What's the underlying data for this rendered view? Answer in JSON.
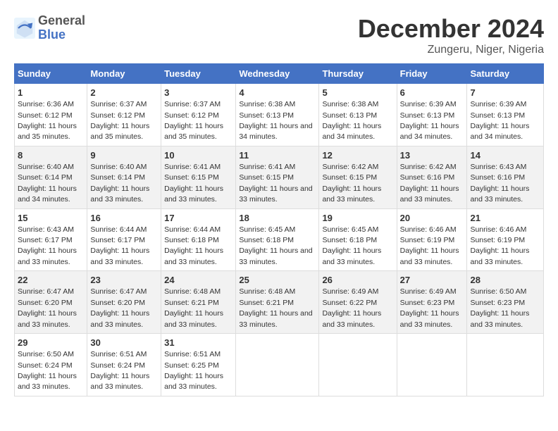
{
  "header": {
    "logo_line1": "General",
    "logo_line2": "Blue",
    "title": "December 2024",
    "subtitle": "Zungeru, Niger, Nigeria"
  },
  "days_of_week": [
    "Sunday",
    "Monday",
    "Tuesday",
    "Wednesday",
    "Thursday",
    "Friday",
    "Saturday"
  ],
  "weeks": [
    [
      {
        "day": "1",
        "sunrise": "6:36 AM",
        "sunset": "6:12 PM",
        "daylight": "11 hours and 35 minutes."
      },
      {
        "day": "2",
        "sunrise": "6:37 AM",
        "sunset": "6:12 PM",
        "daylight": "11 hours and 35 minutes."
      },
      {
        "day": "3",
        "sunrise": "6:37 AM",
        "sunset": "6:12 PM",
        "daylight": "11 hours and 35 minutes."
      },
      {
        "day": "4",
        "sunrise": "6:38 AM",
        "sunset": "6:13 PM",
        "daylight": "11 hours and 34 minutes."
      },
      {
        "day": "5",
        "sunrise": "6:38 AM",
        "sunset": "6:13 PM",
        "daylight": "11 hours and 34 minutes."
      },
      {
        "day": "6",
        "sunrise": "6:39 AM",
        "sunset": "6:13 PM",
        "daylight": "11 hours and 34 minutes."
      },
      {
        "day": "7",
        "sunrise": "6:39 AM",
        "sunset": "6:13 PM",
        "daylight": "11 hours and 34 minutes."
      }
    ],
    [
      {
        "day": "8",
        "sunrise": "6:40 AM",
        "sunset": "6:14 PM",
        "daylight": "11 hours and 34 minutes."
      },
      {
        "day": "9",
        "sunrise": "6:40 AM",
        "sunset": "6:14 PM",
        "daylight": "11 hours and 33 minutes."
      },
      {
        "day": "10",
        "sunrise": "6:41 AM",
        "sunset": "6:15 PM",
        "daylight": "11 hours and 33 minutes."
      },
      {
        "day": "11",
        "sunrise": "6:41 AM",
        "sunset": "6:15 PM",
        "daylight": "11 hours and 33 minutes."
      },
      {
        "day": "12",
        "sunrise": "6:42 AM",
        "sunset": "6:15 PM",
        "daylight": "11 hours and 33 minutes."
      },
      {
        "day": "13",
        "sunrise": "6:42 AM",
        "sunset": "6:16 PM",
        "daylight": "11 hours and 33 minutes."
      },
      {
        "day": "14",
        "sunrise": "6:43 AM",
        "sunset": "6:16 PM",
        "daylight": "11 hours and 33 minutes."
      }
    ],
    [
      {
        "day": "15",
        "sunrise": "6:43 AM",
        "sunset": "6:17 PM",
        "daylight": "11 hours and 33 minutes."
      },
      {
        "day": "16",
        "sunrise": "6:44 AM",
        "sunset": "6:17 PM",
        "daylight": "11 hours and 33 minutes."
      },
      {
        "day": "17",
        "sunrise": "6:44 AM",
        "sunset": "6:18 PM",
        "daylight": "11 hours and 33 minutes."
      },
      {
        "day": "18",
        "sunrise": "6:45 AM",
        "sunset": "6:18 PM",
        "daylight": "11 hours and 33 minutes."
      },
      {
        "day": "19",
        "sunrise": "6:45 AM",
        "sunset": "6:18 PM",
        "daylight": "11 hours and 33 minutes."
      },
      {
        "day": "20",
        "sunrise": "6:46 AM",
        "sunset": "6:19 PM",
        "daylight": "11 hours and 33 minutes."
      },
      {
        "day": "21",
        "sunrise": "6:46 AM",
        "sunset": "6:19 PM",
        "daylight": "11 hours and 33 minutes."
      }
    ],
    [
      {
        "day": "22",
        "sunrise": "6:47 AM",
        "sunset": "6:20 PM",
        "daylight": "11 hours and 33 minutes."
      },
      {
        "day": "23",
        "sunrise": "6:47 AM",
        "sunset": "6:20 PM",
        "daylight": "11 hours and 33 minutes."
      },
      {
        "day": "24",
        "sunrise": "6:48 AM",
        "sunset": "6:21 PM",
        "daylight": "11 hours and 33 minutes."
      },
      {
        "day": "25",
        "sunrise": "6:48 AM",
        "sunset": "6:21 PM",
        "daylight": "11 hours and 33 minutes."
      },
      {
        "day": "26",
        "sunrise": "6:49 AM",
        "sunset": "6:22 PM",
        "daylight": "11 hours and 33 minutes."
      },
      {
        "day": "27",
        "sunrise": "6:49 AM",
        "sunset": "6:23 PM",
        "daylight": "11 hours and 33 minutes."
      },
      {
        "day": "28",
        "sunrise": "6:50 AM",
        "sunset": "6:23 PM",
        "daylight": "11 hours and 33 minutes."
      }
    ],
    [
      {
        "day": "29",
        "sunrise": "6:50 AM",
        "sunset": "6:24 PM",
        "daylight": "11 hours and 33 minutes."
      },
      {
        "day": "30",
        "sunrise": "6:51 AM",
        "sunset": "6:24 PM",
        "daylight": "11 hours and 33 minutes."
      },
      {
        "day": "31",
        "sunrise": "6:51 AM",
        "sunset": "6:25 PM",
        "daylight": "11 hours and 33 minutes."
      },
      null,
      null,
      null,
      null
    ]
  ]
}
